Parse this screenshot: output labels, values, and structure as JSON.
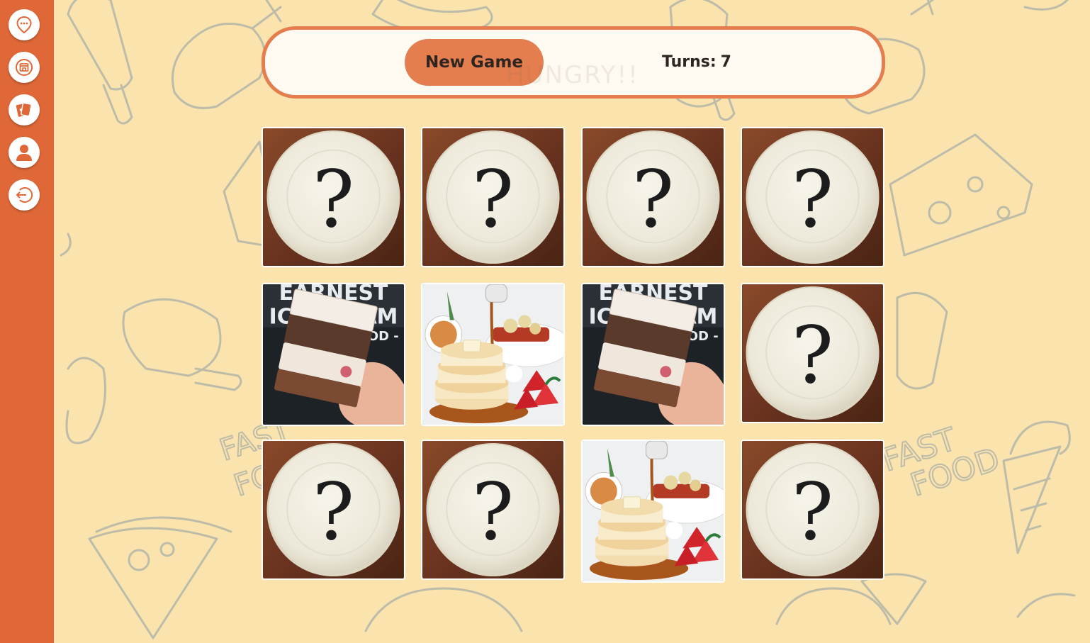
{
  "sidebar": {
    "items": [
      {
        "name": "nav-location",
        "icon": "location-pin-icon"
      },
      {
        "name": "nav-restaurant",
        "icon": "storefront-icon"
      },
      {
        "name": "nav-cards",
        "icon": "cards-icon"
      },
      {
        "name": "nav-profile",
        "icon": "user-icon"
      },
      {
        "name": "nav-logout",
        "icon": "logout-icon"
      }
    ]
  },
  "header": {
    "new_game_label": "New Game",
    "turns_label": "Turns:",
    "turns_value": "7",
    "watermark": "HUNGRY!!"
  },
  "board": {
    "columns": 4,
    "rows": 3,
    "cards": [
      {
        "state": "hidden",
        "face": "plate-question"
      },
      {
        "state": "hidden",
        "face": "plate-question"
      },
      {
        "state": "hidden",
        "face": "plate-question"
      },
      {
        "state": "hidden",
        "face": "plate-question"
      },
      {
        "state": "revealed",
        "face": "ice-cream-sandwich"
      },
      {
        "state": "revealed",
        "face": "souffle-pancakes"
      },
      {
        "state": "revealed",
        "face": "ice-cream-sandwich"
      },
      {
        "state": "hidden",
        "face": "plate-question"
      },
      {
        "state": "hidden",
        "face": "plate-question"
      },
      {
        "state": "hidden",
        "face": "plate-question"
      },
      {
        "state": "revealed",
        "face": "souffle-pancakes"
      },
      {
        "state": "hidden",
        "face": "plate-question"
      }
    ]
  },
  "colors": {
    "background": "#fae3ad",
    "sidebar": "#e06838",
    "accent": "#e57e4f",
    "text": "#2e2521"
  }
}
